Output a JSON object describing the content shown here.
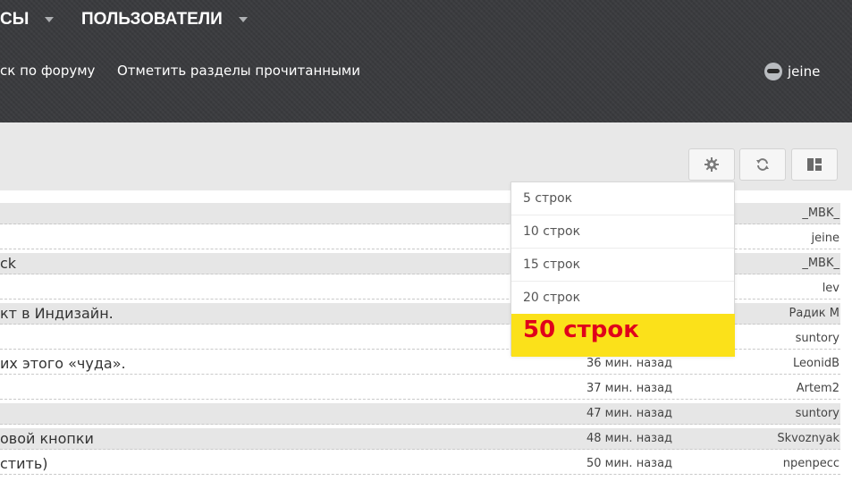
{
  "nav": {
    "items": [
      {
        "label": "СЫ"
      },
      {
        "label": "ПОЛЬЗОВАТЕЛИ"
      }
    ],
    "sublinks": [
      {
        "label": "ск по форуму"
      },
      {
        "label": "Отметить разделы прочитанными"
      }
    ],
    "user": {
      "name": "jeine"
    }
  },
  "toolbar": {
    "icons": [
      "gear-icon",
      "refresh-icon",
      "layout-icon"
    ]
  },
  "rows": [
    {
      "title": "",
      "time": "",
      "author": "_MBK_"
    },
    {
      "title": "",
      "time": "",
      "author": "jeine"
    },
    {
      "title": "ck",
      "time": "",
      "author": "_MBK_"
    },
    {
      "title": "",
      "time": "",
      "author": "lev"
    },
    {
      "title": "кт в Индизайн.",
      "time": "",
      "author": "Радик М"
    },
    {
      "title": "",
      "time": "",
      "author": "suntory"
    },
    {
      "title": "их этого «чуда».",
      "time": "36 мин. назад",
      "author": "LeonidB"
    },
    {
      "title": "",
      "time": "37 мин. назад",
      "author": "Artem2"
    },
    {
      "title": "",
      "time": "47 мин. назад",
      "author": "suntory"
    },
    {
      "title": "овой кнопки",
      "time": "48 мин. назад",
      "author": "Skvoznyak"
    },
    {
      "title": "стить)",
      "time": "50 мин. назад",
      "author": "npenpecc"
    }
  ],
  "dropdown": {
    "options": [
      {
        "label": "5 строк"
      },
      {
        "label": "10 строк"
      },
      {
        "label": "15 строк"
      },
      {
        "label": "20 строк"
      },
      {
        "label": "50 строк"
      }
    ],
    "highlight_color": "#fbe11a",
    "highlight_text_color": "#e0001b"
  }
}
